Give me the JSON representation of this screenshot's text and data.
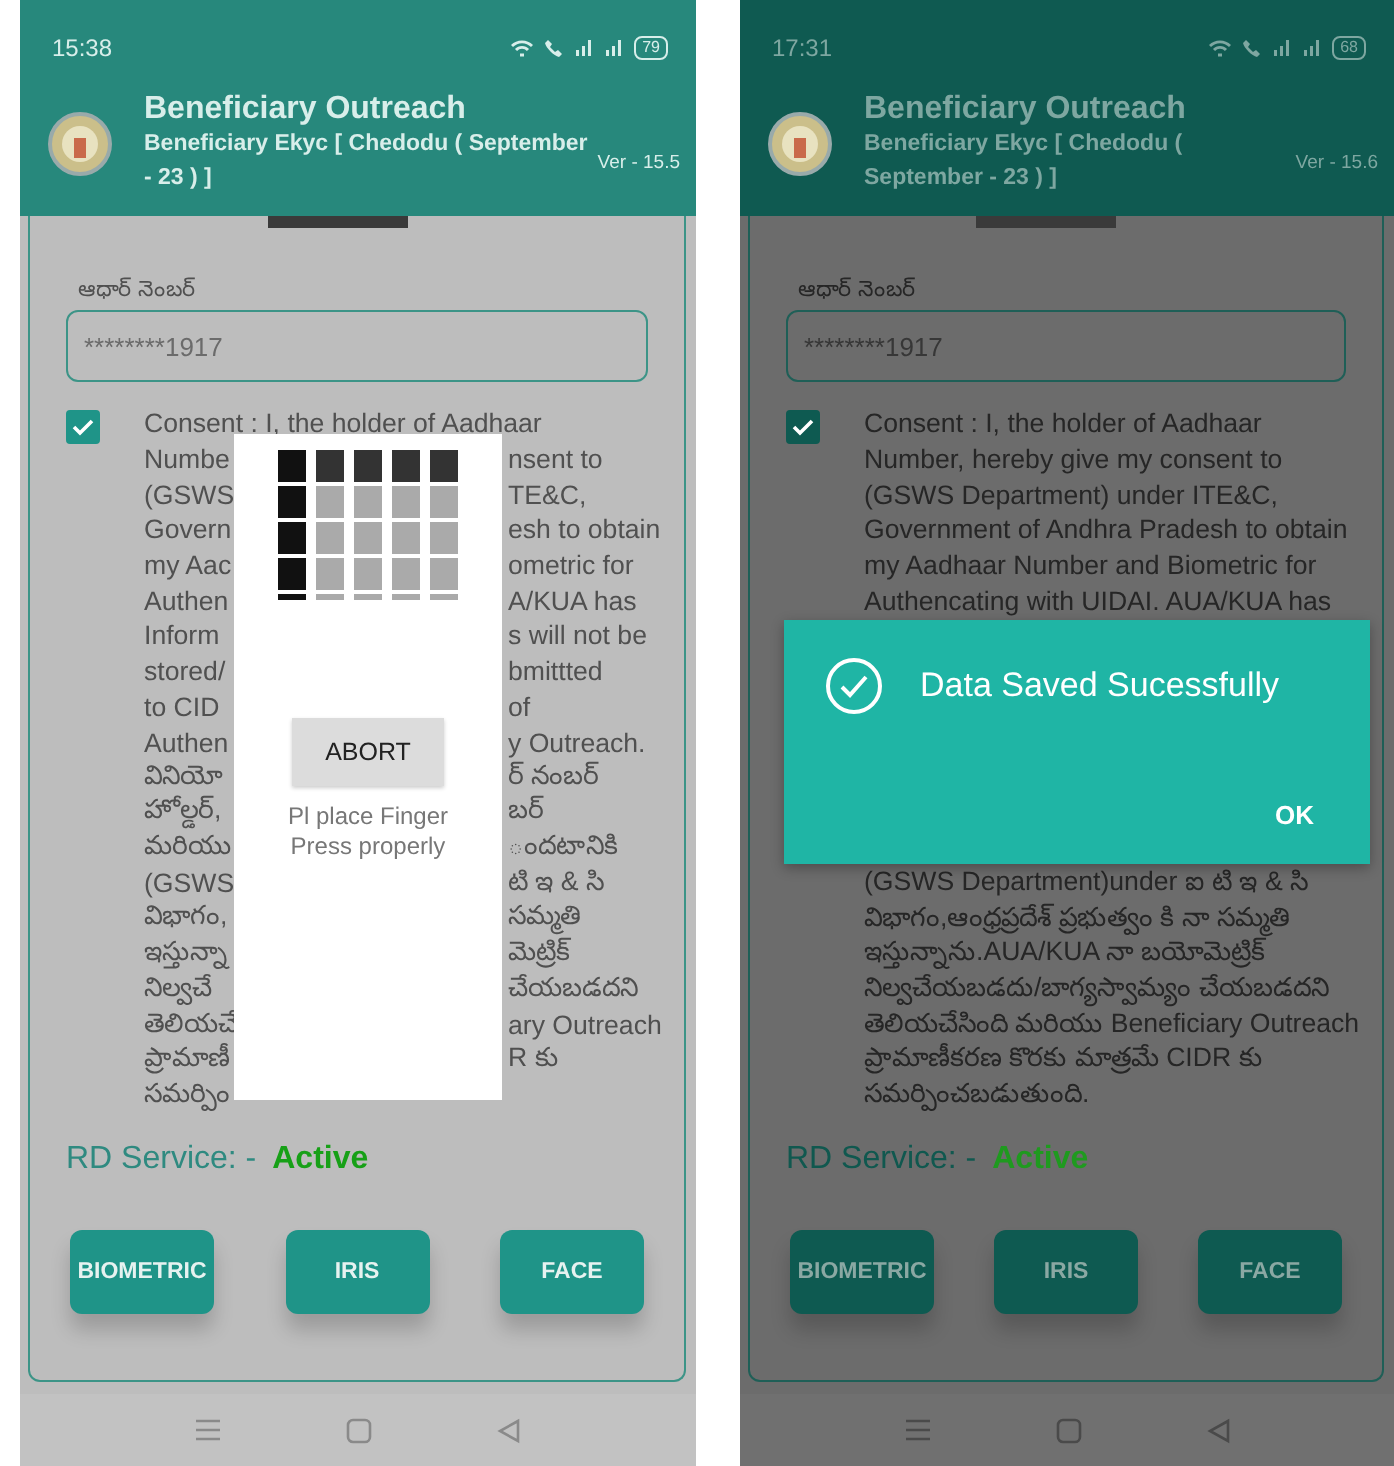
{
  "phones": [
    {
      "kind": "capture",
      "status_bar": {
        "time": "15:38",
        "battery": "79"
      },
      "header": {
        "title": "Beneficiary Outreach",
        "subtitle": "Beneficiary Ekyc [  Chedodu ( September - 23 ) ]",
        "version": "Ver - 15.5"
      },
      "aadhaar": {
        "label": "ఆధార్ నెంబర్",
        "value": "********1917"
      },
      "consent": {
        "checked": true,
        "lines": [
          {
            "text": "Consent : I, the holder of Aadhaar"
          },
          {
            "text": "Numbe",
            "tail": "nsent to"
          },
          {
            "text": "(GSWS",
            "tail": "TE&C,"
          },
          {
            "text": "Govern",
            "tail": "esh to obtain"
          },
          {
            "text": "my Aac",
            "tail": "ometric for"
          },
          {
            "text": "Authen",
            "tail": "A/KUA has"
          },
          {
            "text": "Inform",
            "tail": "s will not be"
          },
          {
            "text": "stored/",
            "tail": "bmittted"
          },
          {
            "text": "to CID",
            "tail": "of"
          },
          {
            "text": "Authen",
            "tail": "y Outreach."
          },
          {
            "text": "వినియో",
            "tail": "ర్ నంబర్"
          },
          {
            "text": "హోల్డర్,",
            "tail": "బర్"
          },
          {
            "text": "మరియు",
            "tail": "ందటానికి"
          },
          {
            "text": "(GSWS",
            "tail": "టి ఇ & సి"
          },
          {
            "text": "విభాగం,",
            "tail": "సమ్మతి"
          },
          {
            "text": "ఇస్తున్నా",
            "tail": "మెట్రిక్"
          },
          {
            "text": "నిల్వచే",
            "tail": "చేయబడదని"
          },
          {
            "text": "తెలియచే",
            "tail": "ary Outreach"
          },
          {
            "text": "ప్రామాణీ",
            "tail": "R కు"
          },
          {
            "text": "సమర్పిం"
          }
        ]
      },
      "rd_service": {
        "label": "RD Service: -",
        "status": "Active"
      },
      "buttons": [
        "BIOMETRIC",
        "IRIS",
        "FACE"
      ],
      "dialog": {
        "kind": "capture",
        "button": "ABORT",
        "hint_lines": [
          "Pl place Finger",
          "Press properly"
        ]
      }
    },
    {
      "kind": "saved",
      "status_bar": {
        "time": "17:31",
        "battery": "68"
      },
      "header": {
        "title": "Beneficiary Outreach",
        "subtitle": "Beneficiary Ekyc [  Chedodu ( September - 23 ) ]",
        "version": "Ver - 15.6"
      },
      "aadhaar": {
        "label": "ఆధార్ నెంబర్",
        "value": "********1917"
      },
      "consent": {
        "checked": true,
        "lines": [
          {
            "text": "Consent : I, the holder of Aadhaar"
          },
          {
            "text": "Number, hereby give my consent to"
          },
          {
            "text": "(GSWS Department) under ITE&C,"
          },
          {
            "text": "Government of Andhra Pradesh to obtain"
          },
          {
            "text": "my Aadhaar Number and Biometric for"
          },
          {
            "text": "Authencating with UIDAI. AUA/KUA has"
          }
        ],
        "lines_after_dialog": [
          {
            "text": "(GSWS Department)under ఐ టి ఇ & సి"
          },
          {
            "text": "విభాగం,ఆంధ్రప్రదేశ్ ప్రభుత్వం కి నా సమ్మతి"
          },
          {
            "text": "ఇస్తున్నాను.AUA/KUA నా బయోమెట్రిక్"
          },
          {
            "text": "నిల్వచేయబడదు/బాగ్యస్వామ్యం చేయబడదని"
          },
          {
            "text": "తెలియచేసింది మరియు Beneficiary Outreach"
          },
          {
            "text": "ప్రామాణీకరణ కొరకు మాత్రమే CIDR కు"
          },
          {
            "text": "సమర్పించబడుతుంది."
          }
        ]
      },
      "rd_service": {
        "label": "RD Service: -",
        "status": "Active"
      },
      "buttons": [
        "BIOMETRIC",
        "IRIS",
        "FACE"
      ],
      "dialog": {
        "kind": "message",
        "message": "Data Saved Sucessfully",
        "button": "OK"
      }
    }
  ]
}
